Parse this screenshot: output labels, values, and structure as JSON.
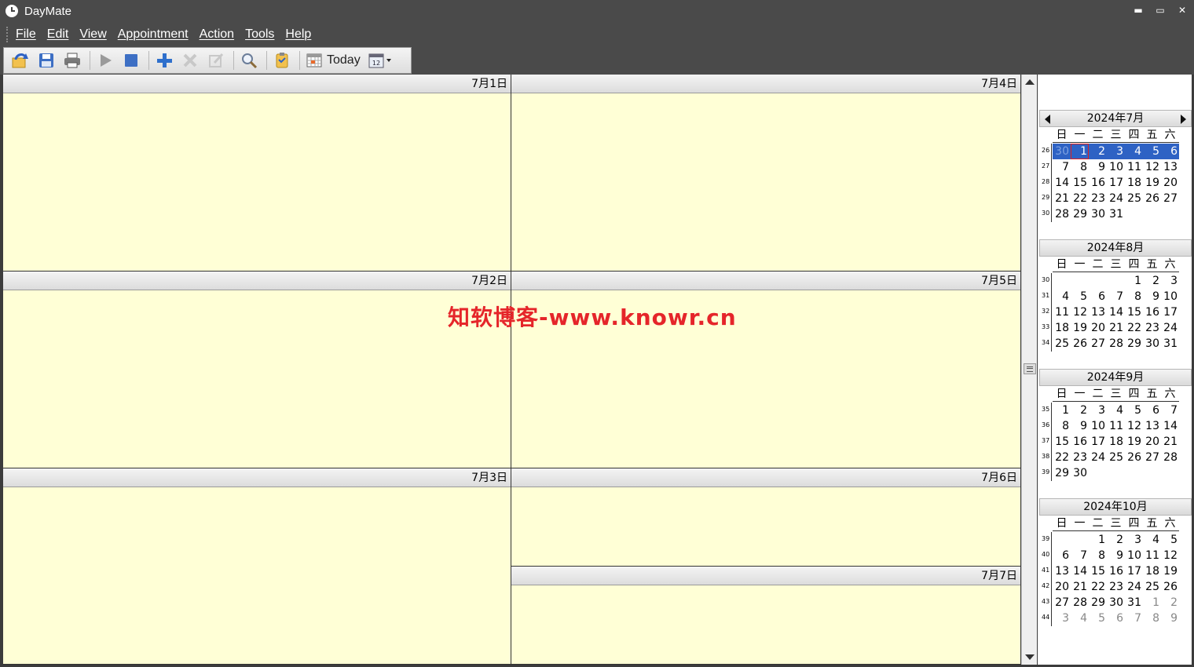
{
  "window": {
    "title": "DayMate",
    "minimize": "▬",
    "restore": "▭",
    "close": "✕"
  },
  "menu": [
    "File",
    "Edit",
    "View",
    "Appointment",
    "Action",
    "Tools",
    "Help"
  ],
  "toolbar": {
    "today_label": "Today",
    "icons": [
      "sync-icon",
      "save-icon",
      "print-icon",
      "play-icon",
      "stop-icon",
      "add-icon",
      "delete-icon",
      "edit-icon",
      "search-icon",
      "tasks-icon",
      "today-calendar-icon",
      "calendar-view-icon"
    ]
  },
  "days": [
    {
      "label": "7月1日"
    },
    {
      "label": "7月2日"
    },
    {
      "label": "7月3日"
    },
    {
      "label": "7月4日"
    },
    {
      "label": "7月5日"
    },
    {
      "label": "7月6日"
    },
    {
      "label": "7月7日"
    }
  ],
  "watermark": "知软博客-www.knowr.cn",
  "mini_calendars": {
    "weekdays": [
      "日",
      "一",
      "二",
      "三",
      "四",
      "五",
      "六"
    ],
    "months": [
      {
        "title": "2024年7月",
        "nav": true,
        "weeks": [
          "26",
          "27",
          "28",
          "29",
          "30"
        ],
        "rows": [
          [
            {
              "d": "30",
              "s": "dimsel"
            },
            {
              "d": "1",
              "s": "selt"
            },
            {
              "d": "2",
              "s": "sel"
            },
            {
              "d": "3",
              "s": "sel"
            },
            {
              "d": "4",
              "s": "sel"
            },
            {
              "d": "5",
              "s": "sel"
            },
            {
              "d": "6",
              "s": "sel"
            }
          ],
          [
            {
              "d": "7"
            },
            {
              "d": "8"
            },
            {
              "d": "9"
            },
            {
              "d": "10"
            },
            {
              "d": "11"
            },
            {
              "d": "12"
            },
            {
              "d": "13"
            }
          ],
          [
            {
              "d": "14"
            },
            {
              "d": "15"
            },
            {
              "d": "16"
            },
            {
              "d": "17"
            },
            {
              "d": "18"
            },
            {
              "d": "19"
            },
            {
              "d": "20"
            }
          ],
          [
            {
              "d": "21"
            },
            {
              "d": "22"
            },
            {
              "d": "23"
            },
            {
              "d": "24"
            },
            {
              "d": "25"
            },
            {
              "d": "26"
            },
            {
              "d": "27"
            }
          ],
          [
            {
              "d": "28"
            },
            {
              "d": "29"
            },
            {
              "d": "30"
            },
            {
              "d": "31"
            },
            {
              "d": ""
            },
            {
              "d": ""
            },
            {
              "d": ""
            }
          ]
        ]
      },
      {
        "title": "2024年8月",
        "nav": false,
        "weeks": [
          "30",
          "31",
          "32",
          "33",
          "34"
        ],
        "rows": [
          [
            {
              "d": ""
            },
            {
              "d": ""
            },
            {
              "d": ""
            },
            {
              "d": ""
            },
            {
              "d": "1"
            },
            {
              "d": "2"
            },
            {
              "d": "3"
            }
          ],
          [
            {
              "d": "4"
            },
            {
              "d": "5"
            },
            {
              "d": "6"
            },
            {
              "d": "7"
            },
            {
              "d": "8"
            },
            {
              "d": "9"
            },
            {
              "d": "10"
            }
          ],
          [
            {
              "d": "11"
            },
            {
              "d": "12"
            },
            {
              "d": "13"
            },
            {
              "d": "14"
            },
            {
              "d": "15"
            },
            {
              "d": "16"
            },
            {
              "d": "17"
            }
          ],
          [
            {
              "d": "18"
            },
            {
              "d": "19"
            },
            {
              "d": "20"
            },
            {
              "d": "21"
            },
            {
              "d": "22"
            },
            {
              "d": "23"
            },
            {
              "d": "24"
            }
          ],
          [
            {
              "d": "25"
            },
            {
              "d": "26"
            },
            {
              "d": "27"
            },
            {
              "d": "28"
            },
            {
              "d": "29"
            },
            {
              "d": "30"
            },
            {
              "d": "31"
            }
          ]
        ]
      },
      {
        "title": "2024年9月",
        "nav": false,
        "weeks": [
          "35",
          "36",
          "37",
          "38",
          "39"
        ],
        "rows": [
          [
            {
              "d": "1"
            },
            {
              "d": "2"
            },
            {
              "d": "3"
            },
            {
              "d": "4"
            },
            {
              "d": "5"
            },
            {
              "d": "6"
            },
            {
              "d": "7"
            }
          ],
          [
            {
              "d": "8"
            },
            {
              "d": "9"
            },
            {
              "d": "10"
            },
            {
              "d": "11"
            },
            {
              "d": "12"
            },
            {
              "d": "13"
            },
            {
              "d": "14"
            }
          ],
          [
            {
              "d": "15"
            },
            {
              "d": "16"
            },
            {
              "d": "17"
            },
            {
              "d": "18"
            },
            {
              "d": "19"
            },
            {
              "d": "20"
            },
            {
              "d": "21"
            }
          ],
          [
            {
              "d": "22"
            },
            {
              "d": "23"
            },
            {
              "d": "24"
            },
            {
              "d": "25"
            },
            {
              "d": "26"
            },
            {
              "d": "27"
            },
            {
              "d": "28"
            }
          ],
          [
            {
              "d": "29"
            },
            {
              "d": "30"
            },
            {
              "d": ""
            },
            {
              "d": ""
            },
            {
              "d": ""
            },
            {
              "d": ""
            },
            {
              "d": ""
            }
          ]
        ]
      },
      {
        "title": "2024年10月",
        "nav": false,
        "weeks": [
          "39",
          "40",
          "41",
          "42",
          "43",
          "44"
        ],
        "rows": [
          [
            {
              "d": ""
            },
            {
              "d": ""
            },
            {
              "d": "1"
            },
            {
              "d": "2"
            },
            {
              "d": "3"
            },
            {
              "d": "4"
            },
            {
              "d": "5"
            }
          ],
          [
            {
              "d": "6"
            },
            {
              "d": "7"
            },
            {
              "d": "8"
            },
            {
              "d": "9"
            },
            {
              "d": "10"
            },
            {
              "d": "11"
            },
            {
              "d": "12"
            }
          ],
          [
            {
              "d": "13"
            },
            {
              "d": "14"
            },
            {
              "d": "15"
            },
            {
              "d": "16"
            },
            {
              "d": "17"
            },
            {
              "d": "18"
            },
            {
              "d": "19"
            }
          ],
          [
            {
              "d": "20"
            },
            {
              "d": "21"
            },
            {
              "d": "22"
            },
            {
              "d": "23"
            },
            {
              "d": "24"
            },
            {
              "d": "25"
            },
            {
              "d": "26"
            }
          ],
          [
            {
              "d": "27"
            },
            {
              "d": "28"
            },
            {
              "d": "29"
            },
            {
              "d": "30"
            },
            {
              "d": "31"
            },
            {
              "d": "1",
              "s": "dim"
            },
            {
              "d": "2",
              "s": "dim"
            }
          ],
          [
            {
              "d": "3",
              "s": "dim"
            },
            {
              "d": "4",
              "s": "dim"
            },
            {
              "d": "5",
              "s": "dim"
            },
            {
              "d": "6",
              "s": "dim"
            },
            {
              "d": "7",
              "s": "dim"
            },
            {
              "d": "8",
              "s": "dim"
            },
            {
              "d": "9",
              "s": "dim"
            }
          ]
        ]
      }
    ]
  },
  "colors": {
    "day_background": "#ffffd6",
    "selection": "#2e62c4",
    "today_outline": "#dd2222",
    "watermark": "#e5252a"
  }
}
